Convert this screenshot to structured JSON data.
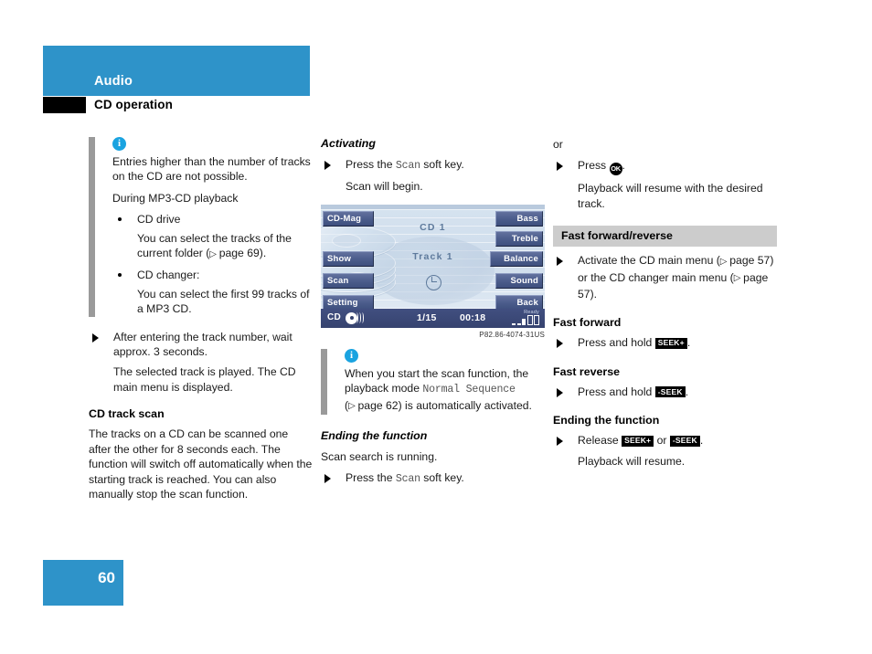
{
  "header": {
    "section_title": "Audio",
    "page_subtitle": "CD operation",
    "band_color": "#2e93c9",
    "box_color": "#000000"
  },
  "footer": {
    "page_number": "60",
    "box_color": "#2e93c9"
  },
  "column_left": {
    "note": {
      "icon": "info-icon",
      "lines": [
        "Entries higher than the number of tracks on the CD are not possible.",
        "During MP3-CD playback"
      ],
      "bullets": [
        {
          "title": "CD drive",
          "body_pre": "You can select the tracks of the current folder (",
          "ref": "page 69",
          "body_post": ")."
        },
        {
          "title": "CD changer:",
          "body_pre": "You can select the first 99 tracks of a MP3 CD.",
          "ref": "",
          "body_post": ""
        }
      ]
    },
    "step": "After entering the track number, wait approx. 3 seconds.",
    "step_result": "The selected track is played. The CD main menu is displayed.",
    "heading_track_scan": "CD track scan",
    "track_scan_body": "The tracks on a CD can be scanned one after the other for 8 seconds each. The function will switch off automatically when the starting track is reached. You can also manually stop the scan function."
  },
  "column_middle": {
    "heading_activating": "Activating",
    "activating_step_pre": "Press the",
    "activating_step_key": "Scan",
    "activating_step_post": "soft key.",
    "activating_result": "Scan will begin.",
    "display": {
      "soft_keys_left": [
        "CD-Mag",
        "Show",
        "Scan",
        "Setting"
      ],
      "soft_keys_right": [
        "Bass",
        "Treble",
        "Balance",
        "Sound",
        "Back"
      ],
      "center_cd": "CD 1",
      "center_track": "Track 1",
      "status_source": "CD",
      "status_track": "1/15",
      "status_time": "00:18",
      "status_ready": "Ready",
      "clock_icon": "clock-icon",
      "disc_icon": "disc-icon"
    },
    "caption": "P82.86-4074-31US",
    "note": {
      "icon": "info-icon",
      "pre": "When you start the scan function, the playback mode",
      "mono": "Normal Sequence",
      "mid": "(",
      "ref": "page 62",
      "post": ") is automatically activated."
    },
    "heading_ending": "Ending the function",
    "ending_body": "Scan search is running.",
    "ending_step_pre": "Press the",
    "ending_step_key": "Scan",
    "ending_step_post": "soft key."
  },
  "column_right": {
    "or_label": "or",
    "press_ok_pre": "Press",
    "press_ok_badge": "OK",
    "press_ok_post": ".",
    "press_ok_result": "Playback will resume with the desired track.",
    "heading_ff_rev": "Fast forward/reverse",
    "activate_step_pre": "Activate the CD main menu (",
    "activate_ref_1": "page 57",
    "activate_step_mid": ") or the CD changer main menu (",
    "activate_ref_2": "page 57",
    "activate_step_post": ").",
    "heading_fast_forward": "Fast forward",
    "ff_step_pre": "Press and hold",
    "ff_key": "SEEK+",
    "ff_step_post": ".",
    "heading_fast_reverse": "Fast reverse",
    "fr_step_pre": "Press and hold",
    "fr_key": "-SEEK",
    "fr_step_post": ".",
    "heading_ending": "Ending the function",
    "release_pre": "Release",
    "release_key_1": "SEEK+",
    "release_or": "or",
    "release_key_2": "-SEEK",
    "release_post": ".",
    "release_result": "Playback will resume."
  }
}
